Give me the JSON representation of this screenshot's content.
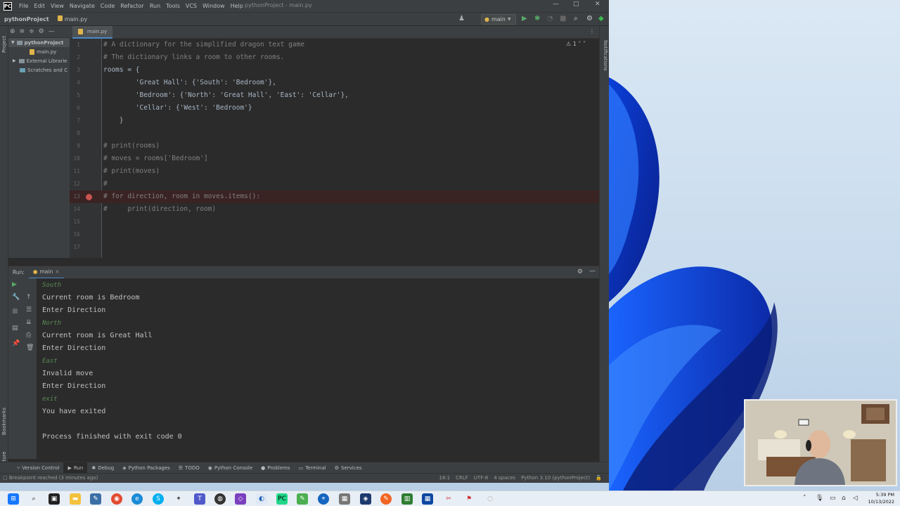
{
  "window": {
    "title": "pythonProject - main.py",
    "menu": [
      "File",
      "Edit",
      "View",
      "Navigate",
      "Code",
      "Refactor",
      "Run",
      "Tools",
      "VCS",
      "Window",
      "Help"
    ]
  },
  "navbar": {
    "project": "pythonProject",
    "file": "main.py",
    "run_config": "main"
  },
  "project_panel": {
    "label": "Project",
    "tree": [
      {
        "label": "pythonProject",
        "type": "folder"
      },
      {
        "label": "main.py",
        "type": "file"
      },
      {
        "label": "External Librarie",
        "type": "folder"
      },
      {
        "label": "Scratches and C",
        "type": "folder"
      }
    ]
  },
  "editor": {
    "tab": "main.py",
    "warnings": "1",
    "lines": [
      {
        "n": "1",
        "text": "# A dictionary for the simplified dragon text game",
        "comment": true
      },
      {
        "n": "2",
        "text": "# The dictionary links a room to other rooms.",
        "comment": true
      },
      {
        "n": "3",
        "text": "rooms = {",
        "comment": false
      },
      {
        "n": "4",
        "text": "        'Great Hall': {'South': 'Bedroom'},",
        "comment": false
      },
      {
        "n": "5",
        "text": "        'Bedroom': {'North': 'Great Hall', 'East': 'Cellar'},",
        "comment": false
      },
      {
        "n": "6",
        "text": "        'Cellar': {'West': 'Bedroom'}",
        "comment": false
      },
      {
        "n": "7",
        "text": "    }",
        "comment": false
      },
      {
        "n": "8",
        "text": "",
        "comment": false
      },
      {
        "n": "9",
        "text": "# print(rooms)",
        "comment": true
      },
      {
        "n": "10",
        "text": "# moves = rooms['Bedroom']",
        "comment": true
      },
      {
        "n": "11",
        "text": "# print(moves)",
        "comment": true
      },
      {
        "n": "12",
        "text": "#",
        "comment": true
      },
      {
        "n": "13",
        "text": "# for direction, room in moves.items():",
        "comment": true,
        "breakpoint": true
      },
      {
        "n": "14",
        "text": "#     print(direction, room)",
        "comment": true
      },
      {
        "n": "15",
        "text": "",
        "comment": false
      },
      {
        "n": "16",
        "text": "",
        "comment": false
      },
      {
        "n": "17",
        "text": "",
        "comment": false
      }
    ]
  },
  "run": {
    "label": "Run:",
    "tab": "main",
    "console": [
      {
        "text": "South",
        "input": true
      },
      {
        "text": "Current room is Bedroom",
        "input": false
      },
      {
        "text": "Enter Direction",
        "input": false
      },
      {
        "text": "North",
        "input": true
      },
      {
        "text": "Current room is Great Hall",
        "input": false
      },
      {
        "text": "Enter Direction",
        "input": false
      },
      {
        "text": "East",
        "input": true
      },
      {
        "text": "Invalid move",
        "input": false
      },
      {
        "text": "Enter Direction",
        "input": false
      },
      {
        "text": "exit",
        "input": true
      },
      {
        "text": "You have exited",
        "input": false
      },
      {
        "text": "",
        "input": false
      },
      {
        "text": "Process finished with exit code 0",
        "input": false
      }
    ]
  },
  "bottom_tabs": [
    "Version Control",
    "Run",
    "Debug",
    "Python Packages",
    "TODO",
    "Python Console",
    "Problems",
    "Terminal",
    "Services"
  ],
  "side_labels": {
    "notifications": "Notifications",
    "bookmarks": "Bookmarks",
    "structure": "Structure"
  },
  "status": {
    "message": "Breakpoint reached (3 minutes ago)",
    "position": "18:1",
    "line_sep": "CRLF",
    "encoding": "UTF-8",
    "indent": "4 spaces",
    "interpreter": "Python 3.10 (pythonProject)"
  },
  "taskbar": {
    "time": "5:39 PM",
    "date": "10/13/2022"
  }
}
